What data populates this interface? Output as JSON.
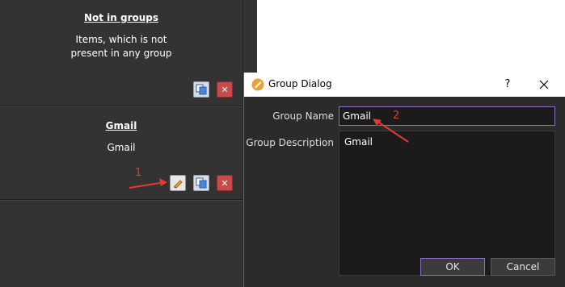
{
  "groups": [
    {
      "title": "Not in groups",
      "desc_line1": "Items, which is not",
      "desc_line2": "present in any group"
    },
    {
      "title": "Gmail",
      "desc_line1": "Gmail"
    }
  ],
  "icons": {
    "edit": "pencil-icon",
    "copy": "copy-icon",
    "delete": "delete-icon"
  },
  "dialog": {
    "title": "Group Dialog",
    "help": "?",
    "name_label": "Group Name",
    "name_value": "Gmail",
    "desc_label": "Group Description",
    "desc_value": "Gmail",
    "ok": "OK",
    "cancel": "Cancel"
  },
  "annotations": {
    "one": "1",
    "two": "2"
  },
  "colors": {
    "accent": "#8e6fc4",
    "annotation": "#e53935",
    "panel": "#333333"
  }
}
